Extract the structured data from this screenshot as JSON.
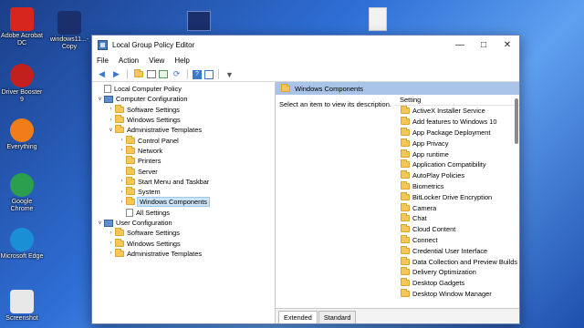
{
  "desktop": {
    "icons": [
      {
        "label": "Adobe Acrobat DC",
        "icon": "acrobat-icon",
        "color": "#d7261e"
      },
      {
        "label": "windows11...-Copy",
        "icon": "image-file-icon",
        "color": "#1a2f6b"
      },
      {
        "label": "Driver Booster 9",
        "icon": "driver-booster-icon",
        "color": "#c21f1f"
      },
      {
        "label": "Everything",
        "icon": "search-app-icon",
        "color": "#f07c1a"
      },
      {
        "label": "Google Chrome",
        "icon": "chrome-icon",
        "color": "#2b9f4e"
      },
      {
        "label": "Microsoft Edge",
        "icon": "edge-icon",
        "color": "#1a8fd6"
      },
      {
        "label": "Screenshot",
        "icon": "screenshot-file-icon",
        "color": "#e8e8e8"
      }
    ]
  },
  "window": {
    "title": "Local Group Policy Editor",
    "menu": [
      "File",
      "Action",
      "View",
      "Help"
    ],
    "tree": [
      {
        "label": "Local Computer Policy",
        "level": 0,
        "type": "doc",
        "chevron": ""
      },
      {
        "label": "Computer Configuration",
        "level": 0,
        "type": "pc",
        "chevron": "v"
      },
      {
        "label": "Software Settings",
        "level": 1,
        "type": "folder",
        "chevron": ">"
      },
      {
        "label": "Windows Settings",
        "level": 1,
        "type": "folder",
        "chevron": ">"
      },
      {
        "label": "Administrative Templates",
        "level": 1,
        "type": "folder",
        "chevron": "v"
      },
      {
        "label": "Control Panel",
        "level": 2,
        "type": "folder",
        "chevron": ">"
      },
      {
        "label": "Network",
        "level": 2,
        "type": "folder",
        "chevron": ">"
      },
      {
        "label": "Printers",
        "level": 2,
        "type": "folder",
        "chevron": ""
      },
      {
        "label": "Server",
        "level": 2,
        "type": "folder",
        "chevron": ""
      },
      {
        "label": "Start Menu and Taskbar",
        "level": 2,
        "type": "folder",
        "chevron": ">"
      },
      {
        "label": "System",
        "level": 2,
        "type": "folder",
        "chevron": ">"
      },
      {
        "label": "Windows Components",
        "level": 2,
        "type": "folder",
        "chevron": ">",
        "selected": true
      },
      {
        "label": "All Settings",
        "level": 2,
        "type": "doc",
        "chevron": ""
      },
      {
        "label": "User Configuration",
        "level": 0,
        "type": "pc",
        "chevron": "v"
      },
      {
        "label": "Software Settings",
        "level": 1,
        "type": "folder",
        "chevron": ">"
      },
      {
        "label": "Windows Settings",
        "level": 1,
        "type": "folder",
        "chevron": ">"
      },
      {
        "label": "Administrative Templates",
        "level": 1,
        "type": "folder",
        "chevron": ">"
      }
    ],
    "right": {
      "header": "Windows Components",
      "description": "Select an item to view its description.",
      "column": "Setting",
      "items": [
        "ActiveX Installer Service",
        "Add features to Windows 10",
        "App Package Deployment",
        "App Privacy",
        "App runtime",
        "Application Compatibility",
        "AutoPlay Policies",
        "Biometrics",
        "BitLocker Drive Encryption",
        "Camera",
        "Chat",
        "Cloud Content",
        "Connect",
        "Credential User Interface",
        "Data Collection and Preview Builds",
        "Delivery Optimization",
        "Desktop Gadgets",
        "Desktop Window Manager"
      ]
    },
    "tabs": [
      "Extended",
      "Standard"
    ]
  }
}
